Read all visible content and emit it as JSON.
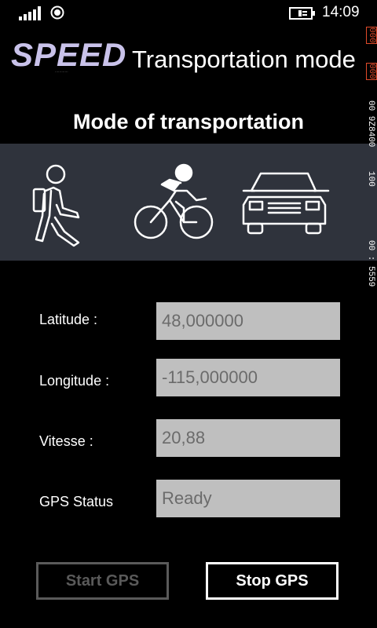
{
  "status_bar": {
    "time": "14:09",
    "icons": [
      "signal-icon",
      "wifi-icon",
      "battery-charging-icon"
    ]
  },
  "header": {
    "brand": "SPEED",
    "brand_sub": "............",
    "title": "Transportation mode"
  },
  "section_title": "Mode of transportation",
  "modes": [
    {
      "name": "walk",
      "icon": "walking-person-icon"
    },
    {
      "name": "bike",
      "icon": "cyclist-icon"
    },
    {
      "name": "car",
      "icon": "car-icon"
    }
  ],
  "fields": [
    {
      "label": "Latitude :",
      "value": "48,000000"
    },
    {
      "label": "Longitude :",
      "value": "-115,000000"
    },
    {
      "label": "Vitesse :",
      "value": "20,88"
    },
    {
      "label": "GPS Status",
      "value": "Ready"
    }
  ],
  "buttons": {
    "start": "Start GPS",
    "stop": "Stop GPS"
  },
  "debug_counters": {
    "a": "000",
    "b": "000",
    "c": "00 9Z8400",
    "d": "100",
    "e": "00 : 5559"
  },
  "colors": {
    "background": "#000000",
    "mode_panel": "#2f333c",
    "field_bg": "#bfbfbf",
    "field_text": "#6b6b6b",
    "brand": "#c9c2ea",
    "counter_red": "#e04a2a",
    "disabled": "#5a5a5a"
  }
}
